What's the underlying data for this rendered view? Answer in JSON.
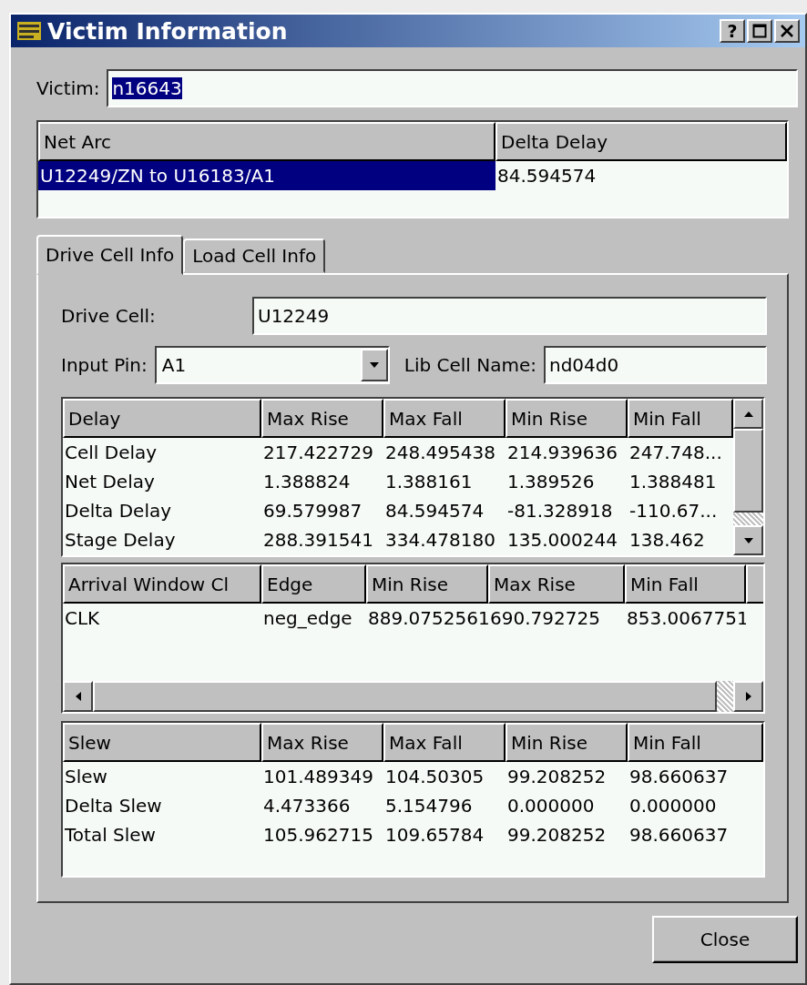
{
  "window": {
    "title": "Victim Information",
    "help_button": "?"
  },
  "victim": {
    "label": "Victim:",
    "value": "n16643",
    "value_selected": true
  },
  "net_arcs": {
    "columns": [
      "Net Arc",
      "Delta Delay"
    ],
    "rows": [
      {
        "cells": [
          "U12249/ZN to U16183/A1",
          "84.594574"
        ],
        "selected": true
      }
    ]
  },
  "tabs": [
    {
      "label": "Drive Cell Info",
      "selected": true
    },
    {
      "label": "Load Cell Info",
      "selected": false
    }
  ],
  "drive_cell": {
    "label": "Drive Cell:",
    "value": "U12249"
  },
  "input_pin": {
    "label": "Input Pin:",
    "value": "A1"
  },
  "lib_cell_name": {
    "label": "Lib Cell Name:",
    "value": "nd04d0"
  },
  "delay_table": {
    "columns": [
      "Delay",
      "Max Rise",
      "Max Fall",
      "Min Rise",
      "Min Fall"
    ],
    "rows": [
      [
        "Cell Delay",
        "217.422729",
        "248.495438",
        "214.939636",
        "247.748..."
      ],
      [
        "Net Delay",
        "1.388824",
        "1.388161",
        "1.389526",
        "1.388481"
      ],
      [
        "Delta Delay",
        "69.579987",
        "84.594574",
        "-81.328918",
        "-110.67..."
      ],
      [
        "Stage Delay",
        "288.391541",
        "334.478180",
        "135.000244",
        "138.462"
      ]
    ]
  },
  "arrival_table": {
    "columns": [
      "Arrival Window Cl",
      "Edge",
      "Min Rise",
      "Max Rise",
      "Min Fall"
    ],
    "rows": [
      [
        "CLK",
        "neg_edge",
        "889.0752561",
        "690.792725",
        "853.0067751"
      ]
    ]
  },
  "slew_table": {
    "columns": [
      "Slew",
      "Max Rise",
      "Max Fall",
      "Min Rise",
      "Min Fall"
    ],
    "rows": [
      [
        "Slew",
        "101.489349",
        "104.50305",
        "99.208252",
        "98.660637"
      ],
      [
        "Delta Slew",
        "4.473366",
        "5.154796",
        "0.000000",
        "0.000000"
      ],
      [
        "Total Slew",
        "105.962715",
        "109.65784",
        "99.208252",
        "98.660637"
      ]
    ]
  },
  "buttons": [
    "Close"
  ]
}
